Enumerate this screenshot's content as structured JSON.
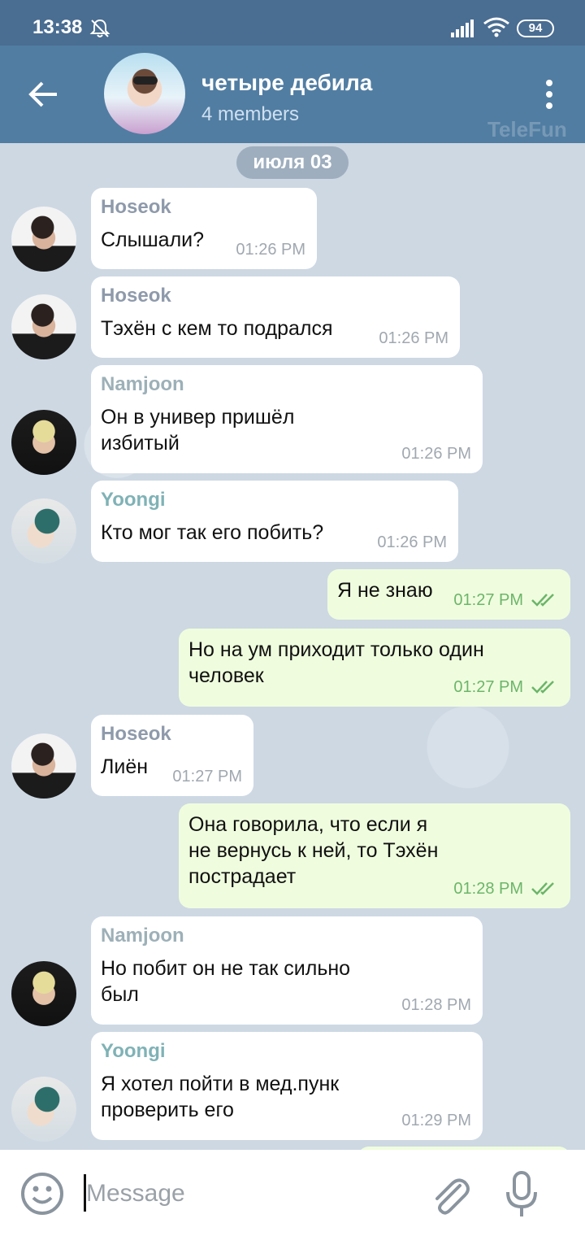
{
  "status_bar": {
    "time": "13:38",
    "battery": "94"
  },
  "header": {
    "title": "четыре дебила",
    "subtitle": "4 members",
    "watermark": "TeleFun"
  },
  "date_separator": "июля 03",
  "messages": [
    {
      "sender": "Hoseok",
      "text": "Слышали?",
      "time": "01:26 PM",
      "sender_color": "#8e9aab"
    },
    {
      "sender": "Hoseok",
      "text": "Тэхён с кем то подрался",
      "time": "01:26 PM",
      "sender_color": "#8e9aab"
    },
    {
      "sender": "Namjoon",
      "text": "Он в универ пришёл\nизбитый",
      "time": "01:26 PM",
      "sender_color": "#9db0b8"
    },
    {
      "sender": "Yoongi",
      "text": "Кто мог так его побить?",
      "time": "01:26 PM",
      "sender_color": "#7fb2b6"
    },
    {
      "text": "Я не знаю",
      "time": "01:27 PM"
    },
    {
      "text": "Но на ум приходит только один\nчеловек",
      "time": "01:27 PM"
    },
    {
      "sender": "Hoseok",
      "text": "Лиён",
      "time": "01:27 PM",
      "sender_color": "#8e9aab"
    },
    {
      "text": "Она говорила, что если я\nне вернусь к ней, то Тэхён\nпострадает",
      "time": "01:28 PM"
    },
    {
      "sender": "Namjoon",
      "text": "Но побит он не так сильно\nбыл",
      "time": "01:28 PM",
      "sender_color": "#9db0b8"
    },
    {
      "sender": "Yoongi",
      "text": "Я хотел пойти в мед.пунк\nпроверить его",
      "time": "01:29 PM",
      "sender_color": "#7fb2b6"
    }
  ],
  "composer": {
    "placeholder": "Message"
  },
  "icons": {
    "back": "arrow-left-icon",
    "more": "more-vertical-icon",
    "mute": "bell-off-icon",
    "emoji": "emoji-icon",
    "attach": "paperclip-icon",
    "mic": "microphone-icon",
    "read": "double-check-icon"
  },
  "colors": {
    "header": "#517da2",
    "status_bar": "#4a6d92",
    "outgoing_bubble": "#effdde",
    "read_check": "#6cb56a"
  }
}
